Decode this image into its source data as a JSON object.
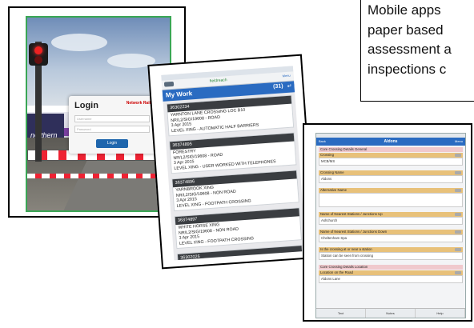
{
  "caption": {
    "lines": [
      "Mobile apps",
      "paper based",
      "assessment a",
      "inspections c"
    ]
  },
  "login_screen": {
    "title": "Login",
    "logo_text": "Network Rail",
    "username_placeholder": "Username",
    "password_placeholder": "Password",
    "login_button": "Login",
    "train_brand": "northern"
  },
  "my_work": {
    "app_logo": "fieldreach",
    "menu_label": "Menu",
    "header_title": "My Work",
    "count": "(31)",
    "items": [
      {
        "id": "36302234",
        "name": "YARNTON LANE CROSSING  LOC B10",
        "ref": "NR/L2/SIG/19608 - ROAD",
        "date": "3 Apr 2015",
        "type": "LEVEL XING - AUTOMATIC HALF BARRIERS"
      },
      {
        "id": "36374895",
        "name": "FORESTRY",
        "ref": "NR/L2/SIG/19608 - ROAD",
        "date": "3 Apr 2015",
        "type": "LEVEL XING - USER WORKED WITH TELEPHONES"
      },
      {
        "id": "36374896",
        "name": "YARNBROOK XING",
        "ref": "NR/L2/SIG/19608 - NON ROAD",
        "date": "3 Apr 2015",
        "type": "LEVEL XING - FOOTPATH CROSSING"
      },
      {
        "id": "36374897",
        "name": "WHITE HORSE XING",
        "ref": "NR/L2/SIG/19608 - NON ROAD",
        "date": "3 Apr 2015",
        "type": "LEVEL XING - FOOTPATH CROSSING"
      },
      {
        "id": "36302026",
        "name": "",
        "ref": "",
        "date": "",
        "type": ""
      }
    ]
  },
  "form": {
    "back_label": "Back",
    "title": "Aldons",
    "menu_label": "Menu",
    "section1": "Core Crossing Details General",
    "crossing_label": "Crossing",
    "crossing_value": "MCB/MS",
    "crossing_name_label": "Crossing Name",
    "crossing_name_value": "Aldons",
    "alt_name_label": "Alternative Name",
    "nearest_up_label": "Name of Nearest Stations / Junctions Up",
    "nearest_up_value": "Ashchurch",
    "nearest_down_label": "Name of Nearest Stations / Junctions Down",
    "nearest_down_value": "Cheltenham Spa",
    "near_station_label": "Is the crossing at or near a station",
    "near_station_value": "Station can be seen from crossing",
    "section2": "Core Crossing Details Location",
    "location_label": "Location on the Road",
    "location_value": "Aldons Lane",
    "tabs": [
      "Text",
      "Notes",
      "Help"
    ]
  }
}
